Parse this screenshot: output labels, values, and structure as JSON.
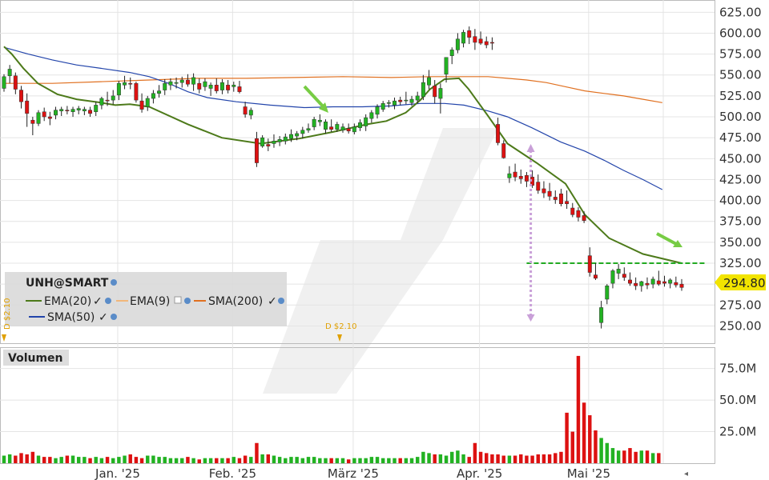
{
  "chart_data": {
    "type": "candlestick",
    "symbol": "UNH@SMART",
    "price_axis": {
      "ticks": [
        "625.00",
        "600.00",
        "575.00",
        "550.00",
        "525.00",
        "500.00",
        "475.00",
        "450.00",
        "425.00",
        "400.00",
        "375.00",
        "350.00",
        "325.00",
        "300.00",
        "275.00",
        "250.00"
      ],
      "ylim": [
        238,
        632
      ]
    },
    "volume_axis": {
      "title": "Volumen",
      "ticks": [
        "75.0M",
        "50.0M",
        "25.0M"
      ],
      "ylim": [
        0,
        90
      ]
    },
    "x_labels": [
      "Jan. '25",
      "Feb. '25",
      "März '25",
      "Apr. '25",
      "Mai '25"
    ],
    "last_price": "294.80",
    "dividends": [
      "D $2.10",
      "D $2.10"
    ],
    "legend": [
      {
        "label": "EMA(20)",
        "color": "#4d7a1a"
      },
      {
        "label": "EMA(9)",
        "color": "#f2b77a"
      },
      {
        "label": "SMA(200)",
        "color": "#e07020"
      },
      {
        "label": "SMA(50)",
        "color": "#2244aa"
      }
    ],
    "candles": [
      [
        534,
        551,
        530,
        548
      ],
      [
        549,
        562,
        540,
        557
      ],
      [
        549,
        553,
        527,
        533
      ],
      [
        532,
        537,
        510,
        518
      ],
      [
        519,
        528,
        488,
        504
      ],
      [
        496,
        500,
        478,
        492
      ],
      [
        492,
        508,
        489,
        505
      ],
      [
        506,
        511,
        495,
        500
      ],
      [
        500,
        506,
        490,
        498
      ],
      [
        502,
        512,
        497,
        508
      ],
      [
        507,
        512,
        501,
        509
      ],
      [
        508,
        513,
        503,
        507
      ],
      [
        506,
        512,
        500,
        509
      ],
      [
        508,
        513,
        503,
        510
      ],
      [
        507,
        512,
        502,
        509
      ],
      [
        508,
        512,
        500,
        504
      ],
      [
        506,
        518,
        501,
        514
      ],
      [
        514,
        524,
        509,
        522
      ],
      [
        520,
        530,
        513,
        519
      ],
      [
        520,
        532,
        515,
        525
      ],
      [
        526,
        543,
        520,
        540
      ],
      [
        538,
        549,
        533,
        541
      ],
      [
        540,
        547,
        533,
        539
      ],
      [
        540,
        542,
        517,
        520
      ],
      [
        519,
        528,
        505,
        509
      ],
      [
        512,
        525,
        507,
        522
      ],
      [
        522,
        532,
        516,
        528
      ],
      [
        528,
        538,
        523,
        531
      ],
      [
        532,
        545,
        526,
        540
      ],
      [
        538,
        546,
        532,
        542
      ],
      [
        540,
        547,
        534,
        541
      ],
      [
        541,
        548,
        535,
        544
      ],
      [
        544,
        551,
        536,
        539
      ],
      [
        539,
        552,
        531,
        547
      ],
      [
        540,
        546,
        528,
        533
      ],
      [
        536,
        546,
        531,
        542
      ],
      [
        534,
        541,
        525,
        538
      ],
      [
        538,
        546,
        528,
        531
      ],
      [
        532,
        545,
        527,
        541
      ],
      [
        538,
        544,
        528,
        532
      ],
      [
        536,
        542,
        530,
        538
      ],
      [
        536,
        543,
        528,
        530
      ],
      [
        512,
        518,
        499,
        503
      ],
      [
        502,
        511,
        497,
        508
      ],
      [
        474,
        482,
        440,
        445
      ],
      [
        465,
        478,
        463,
        475
      ],
      [
        467,
        474,
        459,
        465
      ],
      [
        468,
        479,
        463,
        471
      ],
      [
        470,
        477,
        465,
        473
      ],
      [
        471,
        480,
        467,
        476
      ],
      [
        474,
        485,
        470,
        479
      ],
      [
        477,
        483,
        472,
        480
      ],
      [
        480,
        488,
        474,
        484
      ],
      [
        484,
        492,
        481,
        486
      ],
      [
        488,
        500,
        484,
        497
      ],
      [
        494,
        503,
        489,
        496
      ],
      [
        485,
        497,
        480,
        494
      ],
      [
        488,
        497,
        482,
        485
      ],
      [
        485,
        494,
        482,
        491
      ],
      [
        484,
        492,
        481,
        488
      ],
      [
        486,
        492,
        480,
        483
      ],
      [
        482,
        492,
        479,
        488
      ],
      [
        487,
        497,
        483,
        493
      ],
      [
        489,
        503,
        483,
        499
      ],
      [
        498,
        508,
        493,
        505
      ],
      [
        503,
        515,
        498,
        512
      ],
      [
        509,
        519,
        506,
        516
      ],
      [
        516,
        520,
        511,
        517
      ],
      [
        514,
        523,
        509,
        519
      ],
      [
        520,
        524,
        514,
        518
      ],
      [
        520,
        530,
        515,
        520
      ],
      [
        517,
        525,
        513,
        521
      ],
      [
        520,
        530,
        516,
        525
      ],
      [
        524,
        550,
        520,
        541
      ],
      [
        538,
        556,
        533,
        547
      ],
      [
        537,
        544,
        516,
        524
      ],
      [
        522,
        540,
        504,
        534
      ],
      [
        551,
        563,
        541,
        571
      ],
      [
        573,
        583,
        563,
        580
      ],
      [
        580,
        600,
        576,
        593
      ],
      [
        588,
        604,
        583,
        601
      ],
      [
        603,
        608,
        587,
        595
      ],
      [
        596,
        605,
        580,
        589
      ],
      [
        593,
        602,
        586,
        588
      ],
      [
        590,
        596,
        582,
        586
      ],
      [
        589,
        595,
        580,
        588
      ],
      [
        491,
        499,
        466,
        469
      ],
      [
        468,
        472,
        450,
        451
      ],
      [
        427,
        441,
        421,
        432
      ],
      [
        434,
        444,
        423,
        428
      ],
      [
        429,
        437,
        420,
        426
      ],
      [
        430,
        434,
        416,
        423
      ],
      [
        428,
        436,
        415,
        418
      ],
      [
        422,
        431,
        408,
        412
      ],
      [
        414,
        423,
        403,
        409
      ],
      [
        411,
        421,
        400,
        405
      ],
      [
        404,
        412,
        396,
        401
      ],
      [
        408,
        414,
        393,
        396
      ],
      [
        399,
        412,
        390,
        396
      ],
      [
        391,
        397,
        380,
        383
      ],
      [
        388,
        392,
        375,
        380
      ],
      [
        382,
        387,
        373,
        376
      ],
      [
        334,
        344,
        309,
        314
      ],
      [
        311,
        325,
        305,
        307
      ],
      [
        254,
        280,
        247,
        272
      ],
      [
        282,
        300,
        276,
        298
      ],
      [
        301,
        318,
        295,
        316
      ],
      [
        313,
        324,
        306,
        318
      ],
      [
        312,
        320,
        304,
        308
      ],
      [
        305,
        314,
        298,
        301
      ],
      [
        301,
        308,
        293,
        298
      ],
      [
        298,
        304,
        291,
        303
      ],
      [
        301,
        308,
        294,
        299
      ],
      [
        300,
        309,
        295,
        306
      ],
      [
        304,
        316,
        298,
        300
      ],
      [
        303,
        310,
        297,
        301
      ],
      [
        301,
        307,
        295,
        305
      ],
      [
        302,
        309,
        296,
        299
      ],
      [
        300,
        306,
        292,
        296
      ]
    ],
    "volume": [
      6,
      7,
      6,
      8,
      7,
      9,
      6,
      5,
      5,
      4,
      5,
      6,
      6,
      5,
      5,
      4,
      5,
      4,
      5,
      4,
      5,
      6,
      7,
      5,
      4,
      6,
      6,
      5,
      5,
      4,
      4,
      4,
      5,
      4,
      3,
      4,
      4,
      4,
      4,
      4,
      5,
      4,
      6,
      5,
      16,
      7,
      7,
      6,
      5,
      4,
      5,
      5,
      4,
      5,
      5,
      4,
      4,
      4,
      4,
      4,
      3,
      4,
      4,
      4,
      5,
      5,
      4,
      4,
      4,
      4,
      4,
      4,
      5,
      9,
      8,
      7,
      7,
      6,
      9,
      10,
      7,
      5,
      16,
      9,
      8,
      7,
      7,
      6,
      6,
      6,
      7,
      6,
      6,
      7,
      7,
      7,
      8,
      9,
      40,
      25,
      85,
      48,
      38,
      26,
      20,
      16,
      12,
      10,
      10,
      12,
      9,
      10,
      10,
      8,
      8
    ],
    "ema20": [
      [
        0,
        584
      ],
      [
        8,
        575
      ],
      [
        20,
        558
      ],
      [
        35,
        540
      ],
      [
        55,
        527
      ],
      [
        75,
        521
      ],
      [
        100,
        517
      ],
      [
        115,
        514
      ],
      [
        130,
        515
      ],
      [
        150,
        512
      ],
      [
        190,
        491
      ],
      [
        225,
        475
      ],
      [
        265,
        468
      ],
      [
        305,
        474
      ],
      [
        340,
        482
      ],
      [
        375,
        491
      ],
      [
        395,
        495
      ],
      [
        415,
        505
      ],
      [
        430,
        520
      ],
      [
        440,
        533
      ],
      [
        455,
        545
      ],
      [
        470,
        546
      ],
      [
        480,
        533
      ],
      [
        500,
        501
      ],
      [
        520,
        468
      ],
      [
        550,
        445
      ],
      [
        580,
        420
      ],
      [
        600,
        383
      ],
      [
        625,
        355
      ],
      [
        660,
        336
      ],
      [
        700,
        325
      ]
    ],
    "sma50": [
      [
        0,
        583
      ],
      [
        25,
        575
      ],
      [
        50,
        568
      ],
      [
        75,
        562
      ],
      [
        100,
        558
      ],
      [
        130,
        553
      ],
      [
        150,
        548
      ],
      [
        170,
        540
      ],
      [
        190,
        530
      ],
      [
        210,
        523
      ],
      [
        240,
        518
      ],
      [
        275,
        514
      ],
      [
        310,
        511
      ],
      [
        340,
        512
      ],
      [
        370,
        512
      ],
      [
        400,
        513
      ],
      [
        430,
        516
      ],
      [
        455,
        516
      ],
      [
        475,
        514
      ],
      [
        500,
        507
      ],
      [
        520,
        500
      ],
      [
        545,
        487
      ],
      [
        575,
        470
      ],
      [
        600,
        459
      ],
      [
        620,
        448
      ],
      [
        640,
        436
      ],
      [
        660,
        425
      ],
      [
        680,
        413
      ]
    ],
    "sma200": [
      [
        0,
        540
      ],
      [
        50,
        540
      ],
      [
        100,
        542
      ],
      [
        150,
        544
      ],
      [
        200,
        546
      ],
      [
        250,
        546
      ],
      [
        300,
        547
      ],
      [
        350,
        548
      ],
      [
        400,
        547
      ],
      [
        440,
        548
      ],
      [
        470,
        548
      ],
      [
        500,
        548
      ],
      [
        520,
        546
      ],
      [
        540,
        544
      ],
      [
        560,
        541
      ],
      [
        580,
        536
      ],
      [
        600,
        531
      ],
      [
        620,
        528
      ],
      [
        640,
        525
      ],
      [
        660,
        521
      ],
      [
        680,
        517
      ]
    ],
    "hline_value": 325
  }
}
